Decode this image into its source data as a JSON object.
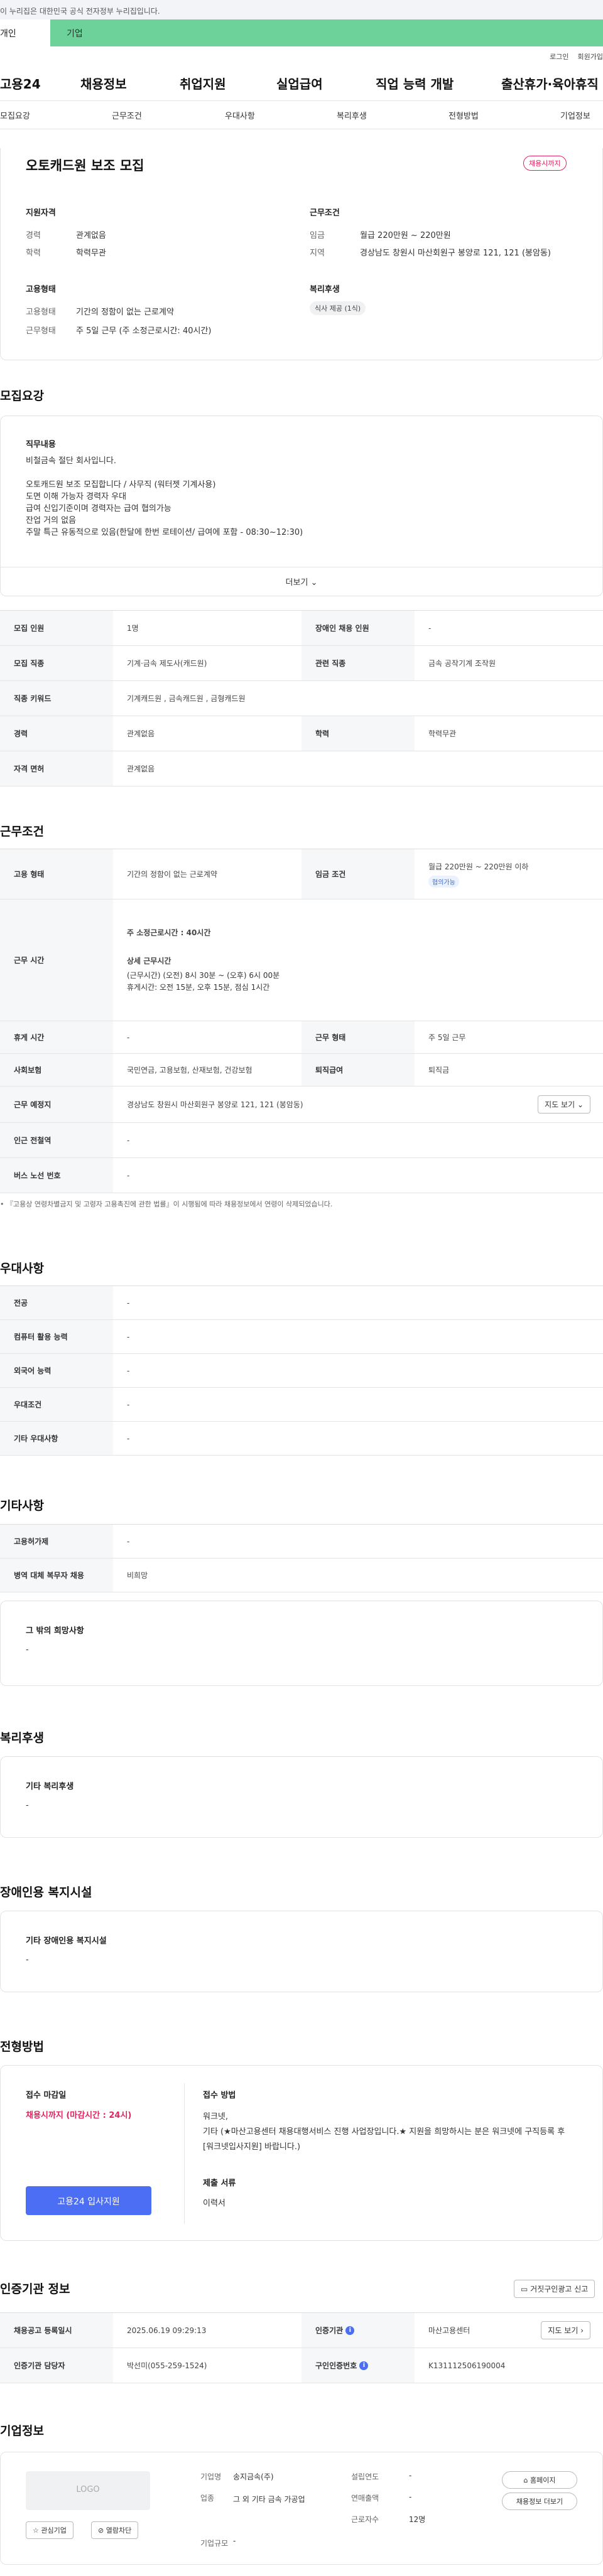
{
  "gov_bar": "이 누리집은 대한민국 공식 전자정부 누리집입니다.",
  "tabs": {
    "person": "개인",
    "biz": "기업"
  },
  "util": {
    "login": "로그인",
    "join": "회원가입"
  },
  "gnb": {
    "logo": "고용24",
    "items": [
      "채용정보",
      "취업지원",
      "실업급여",
      "직업 능력 개발",
      "출산휴가·육아휴직"
    ]
  },
  "subnav": [
    "모집요강",
    "근무조건",
    "우대사항",
    "복리후생",
    "전형방법",
    "기업정보"
  ],
  "summary": {
    "title": "오토캐드원 보조 모집",
    "status_badge": "채용시까지",
    "qual_title": "지원자격",
    "career_label": "경력",
    "career_value": "관계없음",
    "edu_label": "학력",
    "edu_value": "학력무관",
    "cond_title": "근무조건",
    "wage_label": "임금",
    "wage_value": "월급 220만원 ~ 220만원",
    "region_label": "지역",
    "region_value": "경상남도 창원시 마산회원구 봉양로 121, 121 (봉암동)",
    "emp_title": "고용형태",
    "emptype_label": "고용형태",
    "emptype_value": "기간의 정함이 없는 근로계약",
    "worktype_label": "근무형태",
    "worktype_value": "주 5일 근무 (주 소정근로시간: 40시간)",
    "welfare_title": "복리후생",
    "welfare_chip": "식사 제공 (1식)"
  },
  "recruit": {
    "heading": "모집요강",
    "duty_title": "직무내용",
    "duty_text": "비철금속 절단 회사입니다.\n\n오토캐드원 보조 모집합니다 / 사무직 (워터젯 기계사용)\n도면 이해 가능자 경력자 우대\n급여 신입기준이며 경력자는 급여 협의가능\n잔업 거의 없음\n주말 특근 유동적으로 있음(한달에 한번 로테이션/ 급여에 포함 - 08:30~12:30)",
    "more": "더보기",
    "rows": [
      {
        "k1": "모집 인원",
        "v1": "1명",
        "k2": "장애인 채용 인원",
        "v2": "-"
      },
      {
        "k1": "모집 직종",
        "v1": "기계·금속 제도사(캐드원)",
        "k2": "관련 직종",
        "v2": "금속 공작기계 조작원"
      },
      {
        "k1": "직종 키워드",
        "v1": "기계캐드원 , 금속캐드원 , 금형캐드원"
      },
      {
        "k1": "경력",
        "v1": "관계없음",
        "k2": "학력",
        "v2": "학력무관"
      },
      {
        "k1": "자격 면허",
        "v1": "관계없음"
      }
    ]
  },
  "conditions": {
    "heading": "근무조건",
    "emp_label": "고용 형태",
    "emp_value": "기간의 정함이 없는 근로계약",
    "wage_label": "임금 조건",
    "wage_value": "월급 220만원 ~ 220만원 이하",
    "wage_badge": "협의가능",
    "hours_label": "근무 시간",
    "hours_main": "주 소정근로시간 : 40시간",
    "hours_detail_title": "상세 근무시간",
    "hours_detail": "(근무시간) (오전) 8시 30분 ~ (오후) 6시 00분\n휴게시간: 오전 15분, 오후 15분, 점심 1시간",
    "rest_label": "휴게 시간",
    "rest_value": "-",
    "worktype_label": "근무 형태",
    "worktype_value": "주 5일 근무",
    "insurance_label": "사회보험",
    "insurance_value": "국민연금, 고용보험, 산재보험, 건강보험",
    "retire_label": "퇴직급여",
    "retire_value": "퇴직금",
    "place_label": "근무 예정지",
    "place_value": "경상남도 창원시 마산회원구 봉양로 121, 121 (봉암동)",
    "map_btn": "지도 보기",
    "station_label": "인근 전철역",
    "station_value": "-",
    "bus_label": "버스 노선 번호",
    "bus_value": "-",
    "note": "『고용상 연령차별금지 및 고령자 고용촉진에 관한 법률』이 시행됨에 따라 채용정보에서 연령이 삭제되었습니다."
  },
  "prefer": {
    "heading": "우대사항",
    "rows": [
      {
        "k": "전공",
        "v": "-"
      },
      {
        "k": "컴퓨터 활용 능력",
        "v": "-"
      },
      {
        "k": "외국어 능력",
        "v": "-"
      },
      {
        "k": "우대조건",
        "v": "-"
      },
      {
        "k": "기타 우대사항",
        "v": "-"
      }
    ]
  },
  "etc": {
    "heading": "기타사항",
    "rows": [
      {
        "k": "고용허가제",
        "v": "-"
      },
      {
        "k": "병역 대체 복무자 채용",
        "v": "비희망"
      }
    ],
    "hope_title": "그 밖의 희망사항",
    "hope_value": "-"
  },
  "welfare": {
    "heading": "복리후생",
    "title": "기타 복리후생",
    "value": "-"
  },
  "disabled": {
    "heading": "장애인용 복지시설",
    "title": "기타 장애인용 복지시설",
    "value": "-"
  },
  "selection": {
    "heading": "전형방법",
    "deadline_title": "접수 마감일",
    "deadline_value": "채용시까지 (마감시간 : 24시)",
    "apply_btn": "고용24 입사지원",
    "method_title": "접수 방법",
    "method_text": "워크넷,\n기타 (★마산고용센터 채용대행서비스 진행 사업장입니다.★ 지원을 희망하시는 분은 워크넷에 구직등록 후 [워크넷입사지원] 바랍니다.)",
    "docs_title": "제출 서류",
    "docs_value": "이력서"
  },
  "agency": {
    "heading": "인증기관 정보",
    "report_btn": "거짓구인광고 신고",
    "reg_label": "채용공고 등록일시",
    "reg_value": "2025.06.19 09:29:13",
    "agency_label": "인증기관",
    "agency_value": "마산고용센터",
    "map_btn": "지도 보기",
    "manager_label": "인증기관 담당자",
    "manager_value": "박선미(055-259-1524)",
    "notice_label": "구인인증번호",
    "notice_value": "K131112506190004"
  },
  "company": {
    "heading": "기업정보",
    "logo": "LOGO",
    "fav_btn": "관심기업",
    "block_btn": "열람차단",
    "name_label": "기업명",
    "name_value": "송지금속(주)",
    "industry_label": "업종",
    "industry_value": "그 외 기타 금속 가공업",
    "size_label": "기업규모",
    "size_value": "-",
    "found_label": "설립연도",
    "found_value": "-",
    "sales_label": "연매출액",
    "sales_value": "-",
    "emp_label": "근로자수",
    "emp_value": "12명",
    "home_btn": "홈페이지",
    "list_btn": "채용정보 더보기"
  }
}
